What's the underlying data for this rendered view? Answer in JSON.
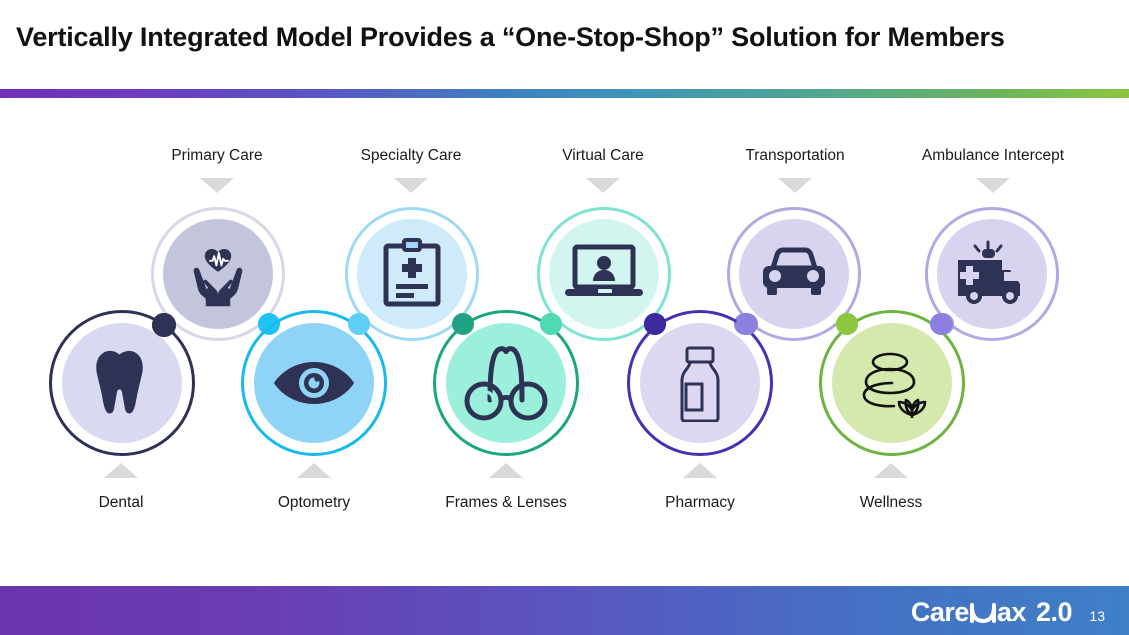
{
  "slide": {
    "title": "Vertically Integrated Model Provides a “One-Stop-Shop” Solution for Members",
    "page_number": "13",
    "accent_bar_colors": [
      "#7230b6",
      "#4472c4",
      "#8cc63f"
    ],
    "footer_colors": [
      "#6b35ad",
      "#3f7fc6"
    ]
  },
  "footer": {
    "brand_care": "Care",
    "brand_ax": "ax",
    "brand_version": "2.0"
  },
  "top_row": [
    {
      "label": "Primary Care",
      "icon": "hands-holding-heart-icon",
      "fill": "#c3c5dc",
      "ring": "#d6d8e8",
      "dot_left": "#2e3254",
      "dot_right": "#21c3f3"
    },
    {
      "label": "Specialty Care",
      "icon": "clipboard-medical-icon",
      "fill": "#cfeafb",
      "ring": "#9fd9f6",
      "dot_left": "#6fd6f7",
      "dot_right": "#23a183"
    },
    {
      "label": "Virtual Care",
      "icon": "laptop-telehealth-icon",
      "fill": "#d2f6ef",
      "ring": "#7fe3d2",
      "dot_left": "#5fd9c4",
      "dot_right": "#3c2a9e"
    },
    {
      "label": "Transportation",
      "icon": "car-front-icon",
      "fill": "#d8d4ef",
      "ring": "#b2a8e2",
      "dot_left": "#8b7fe0",
      "dot_right": "#8dc63f"
    },
    {
      "label": "Ambulance Intercept",
      "icon": "ambulance-icon",
      "fill": "#d8d4ef",
      "ring": "#b2a8e2",
      "dot_left": "#9b8fe4",
      "dot_right": ""
    }
  ],
  "bottom_row": [
    {
      "label": "Dental",
      "icon": "tooth-icon",
      "fill": "#d9daf2",
      "ring": "#2e3254",
      "dot": "#2e3254"
    },
    {
      "label": "Optometry",
      "icon": "eye-icon",
      "fill": "#8fd3f7",
      "ring": "#17b9ef",
      "dot": "#5fcff5"
    },
    {
      "label": "Frames & Lenses",
      "icon": "eyeglasses-icon",
      "fill": "#9bf0dc",
      "ring": "#19a780",
      "dot": "#4fd9b5"
    },
    {
      "label": "Pharmacy",
      "icon": "medicine-bottle-icon",
      "fill": "#ddd7f2",
      "ring": "#4a2fb5",
      "dot": "#9b8fe4"
    },
    {
      "label": "Wellness",
      "icon": "zen-stones-lotus-icon",
      "fill": "#d5e8ae",
      "ring": "#6cb33f",
      "dot": "#8b7fe0"
    }
  ]
}
